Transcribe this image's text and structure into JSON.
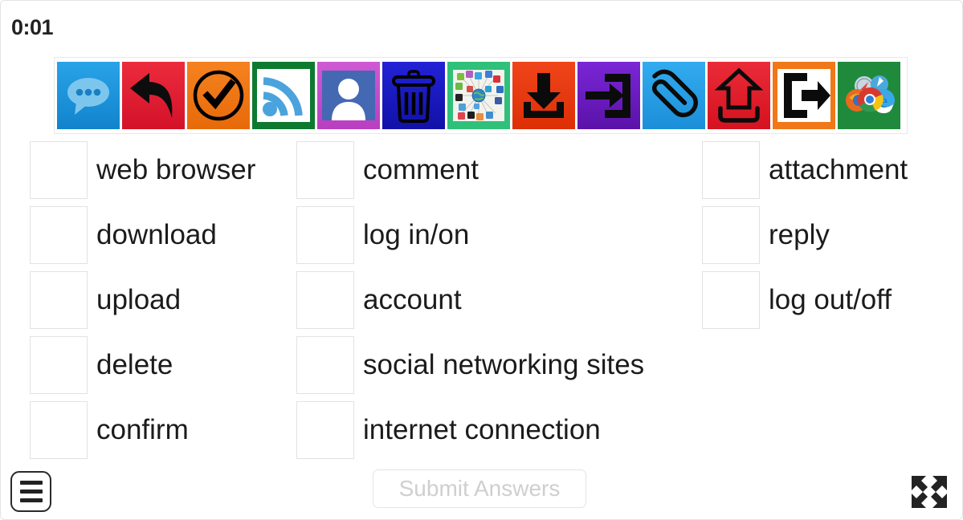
{
  "timer": {
    "value": "0:01"
  },
  "icon_strip": {
    "icons": [
      {
        "name": "comment-speech-bubble-icon",
        "bg": "#1e9ae0",
        "label": "comment"
      },
      {
        "name": "reply-arrow-icon",
        "bg": "#e32636",
        "label": "reply"
      },
      {
        "name": "confirm-check-circle-icon",
        "bg": "#f07818",
        "label": "confirm"
      },
      {
        "name": "rss-internet-connection-icon",
        "bg": "#ffffff",
        "border": "#0e7a2f",
        "label": "internet connection"
      },
      {
        "name": "account-person-icon",
        "bg": "#cc52cc",
        "inner": "#4568b2",
        "label": "account"
      },
      {
        "name": "delete-trash-icon",
        "bg": "#1a1ac4",
        "label": "delete"
      },
      {
        "name": "social-networking-sites-icon",
        "bg": "#2fc07a",
        "inner": "#f2f2ee",
        "label": "social networking sites"
      },
      {
        "name": "download-arrow-icon",
        "bg": "#ee3b12",
        "label": "download"
      },
      {
        "name": "log-in-arrow-icon",
        "bg": "#6a1fc0",
        "label": "log in/on"
      },
      {
        "name": "attachment-paperclip-icon",
        "bg": "#2b9fe8",
        "label": "attachment"
      },
      {
        "name": "upload-arrow-icon",
        "bg": "#e8232f",
        "label": "upload"
      },
      {
        "name": "log-out-arrow-icon",
        "bg": "#ffffff",
        "border": "#f07818",
        "label": "log out/off"
      },
      {
        "name": "web-browser-logos-icon",
        "bg": "#1f8a3c",
        "label": "web browser"
      }
    ]
  },
  "answers": {
    "input_value": "",
    "columns": [
      {
        "items": [
          {
            "label": "web browser",
            "value": ""
          },
          {
            "label": "download",
            "value": ""
          },
          {
            "label": "upload",
            "value": ""
          },
          {
            "label": "delete",
            "value": ""
          },
          {
            "label": "confirm",
            "value": ""
          }
        ]
      },
      {
        "items": [
          {
            "label": "comment",
            "value": ""
          },
          {
            "label": "log in/on",
            "value": ""
          },
          {
            "label": "account",
            "value": ""
          },
          {
            "label": "social networking sites",
            "value": ""
          },
          {
            "label": "internet connection",
            "value": ""
          }
        ]
      },
      {
        "items": [
          {
            "label": "attachment",
            "value": ""
          },
          {
            "label": "reply",
            "value": ""
          },
          {
            "label": "log out/off",
            "value": ""
          }
        ]
      }
    ]
  },
  "bottom_bar": {
    "menu_icon": "hamburger-menu-icon",
    "submit_label": "Submit Answers",
    "fullscreen_icon": "fullscreen-expand-icon"
  }
}
